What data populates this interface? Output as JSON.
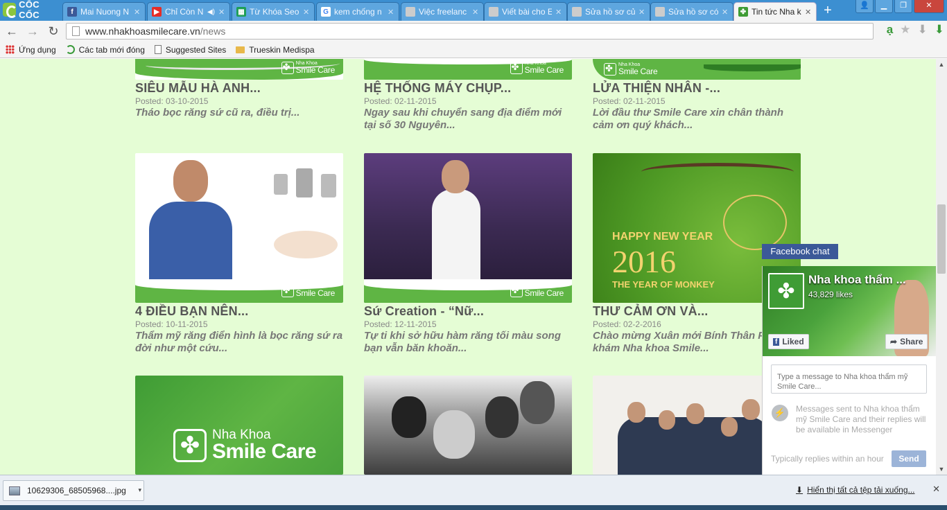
{
  "browser": {
    "brand": "CỐC CỐC",
    "tabs": [
      {
        "title": "Mai Nuong N",
        "favicon": "facebook-icon",
        "color": "#3b5998"
      },
      {
        "title": "Chỉ Còn N",
        "favicon": "youtube-icon",
        "color": "#e52d27",
        "audio": true
      },
      {
        "title": "Từ Khóa Seo",
        "favicon": "sheets-icon",
        "color": "#1e9e57"
      },
      {
        "title": "kem chống n",
        "favicon": "google-icon",
        "color": "#ffffff"
      },
      {
        "title": "Việc freelanc",
        "favicon": "page-icon",
        "color": "#cccccc"
      },
      {
        "title": "Viết bài cho E",
        "favicon": "page-icon",
        "color": "#cccccc"
      },
      {
        "title": "Sửa hồ sơ củ",
        "favicon": "page-icon",
        "color": "#cccccc"
      },
      {
        "title": "Sửa hồ sơ cớ",
        "favicon": "page-icon",
        "color": "#cccccc"
      },
      {
        "title": "Tin tức Nha k",
        "favicon": "clover-icon",
        "color": "#3f9c35",
        "active": true
      }
    ],
    "new_tab": "+",
    "url_host": "www.nhakhoasmilecare.vn",
    "url_path": "/news",
    "bookmarks": [
      {
        "label": "Ứng dụng",
        "icon": "apps-icon"
      },
      {
        "label": "Các tab mới đóng",
        "icon": "history-icon"
      },
      {
        "label": "Suggested Sites",
        "icon": "page-icon"
      },
      {
        "label": "Trueskin Medispa",
        "icon": "folder-icon"
      }
    ]
  },
  "brand_badge": {
    "small": "Nha Khoa",
    "big": "Smile Care"
  },
  "posts": [
    {
      "title": "SIÊU MẪU HÀ ANH...",
      "date": "Posted: 03-10-2015",
      "excerpt": "Tháo bọc răng sứ cũ ra, điều trị..."
    },
    {
      "title": "HỆ THỐNG MÁY CHỤP...",
      "date": "Posted: 02-11-2015",
      "excerpt": "Ngay sau khi chuyển sang địa điểm mới tại số 30 Nguyên..."
    },
    {
      "title": "LỬA THIỆN NHÂN -...",
      "date": "Posted: 02-11-2015",
      "excerpt": "Lời đầu thư Smile Care xin chân thành cảm ơn quý khách..."
    },
    {
      "title": "4 ĐIỀU BẠN NÊN...",
      "date": "Posted: 10-11-2015",
      "excerpt": "Thẩm mỹ răng điển hình là bọc răng sứ ra đời như một cứu..."
    },
    {
      "title": "Sứ Creation - “Nữ...",
      "date": "Posted: 12-11-2015",
      "excerpt": "Tự ti khi sở hữu hàm răng tối màu song bạn vẫn băn khoăn..."
    },
    {
      "title": "THƯ CẢM ƠN VÀ...",
      "date": "Posted: 02-2-2016",
      "excerpt": "Chào mừng Xuân mới Bính Thân Phòng khám Nha khoa Smile..."
    }
  ],
  "newyear_card": {
    "line1": "HAPPY NEW YEAR",
    "year": "2016",
    "line2": "THE YEAR OF MONKEY"
  },
  "logo_card": {
    "small": "Nha Khoa",
    "big": "Smile Care"
  },
  "facebook": {
    "tab_label": "Facebook chat",
    "page_name": "Nha khoa thẩm ...",
    "likes": "43,829 likes",
    "liked_label": "Liked",
    "share_label": "Share",
    "input_placeholder": "Type a message to Nha khoa thẩm mỹ Smile Care...",
    "note": "Messages sent to Nha khoa thẩm mỹ Smile Care and their replies will be available in Messenger",
    "reply_time": "Typically replies within an hour",
    "send_label": "Send"
  },
  "downloads": {
    "file": "10629306_68505968....jpg",
    "show_all": "Hiển thị tất cả tệp tải xuống..."
  }
}
